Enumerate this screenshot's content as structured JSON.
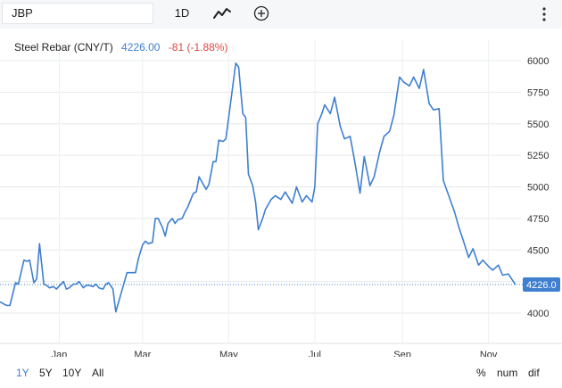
{
  "toolbar": {
    "symbol_value": "JBP",
    "interval_label": "1D",
    "chart_type_icon": "line-chart-icon",
    "add_icon": "plus-circle-icon",
    "more_icon": "vertical-dots-icon"
  },
  "legend": {
    "name": "Steel Rebar (CNY/T)",
    "price": "4226.00",
    "change": "-81 (-1.88%)"
  },
  "colors": {
    "line": "#3f7fd0",
    "change_negative": "#e0463f",
    "last_price_label_bg": "#3f7fd0"
  },
  "bottom": {
    "ranges": [
      "1Y",
      "5Y",
      "10Y",
      "All"
    ],
    "active_range": "1Y",
    "modes": [
      "%",
      "num",
      "dif"
    ]
  },
  "chart_data": {
    "type": "line",
    "title": "Steel Rebar (CNY/T)",
    "last_value": 4226.0,
    "last_value_label": "4226.0",
    "ylim": [
      3750,
      6100
    ],
    "yticks": [
      4000,
      4250,
      4500,
      4750,
      5000,
      5250,
      5500,
      5750,
      6000
    ],
    "ytick_labels": [
      "4000",
      "4250",
      "4500",
      "4750",
      "5000",
      "5250",
      "5500",
      "5750",
      "6000"
    ],
    "xlim": [
      "2020-11-20",
      "2021-11-24"
    ],
    "xticks": [
      {
        "date": "2021-01-01",
        "label": "Jan"
      },
      {
        "date": "2021-03-01",
        "label": "Mar"
      },
      {
        "date": "2021-05-01",
        "label": "May"
      },
      {
        "date": "2021-07-01",
        "label": "Jul"
      },
      {
        "date": "2021-09-01",
        "label": "Sep"
      },
      {
        "date": "2021-11-01",
        "label": "Nov"
      }
    ],
    "grid": true,
    "series": [
      {
        "x": [
          "2020-11-20",
          "2020-11-23",
          "2020-11-25",
          "2020-11-27",
          "2020-12-01",
          "2020-12-03",
          "2020-12-07",
          "2020-12-09",
          "2020-12-11",
          "2020-12-14",
          "2020-12-16",
          "2020-12-18",
          "2020-12-21",
          "2020-12-23",
          "2020-12-25",
          "2020-12-28",
          "2020-12-30",
          "2021-01-04",
          "2021-01-06",
          "2021-01-08",
          "2021-01-11",
          "2021-01-13",
          "2021-01-15",
          "2021-01-18",
          "2021-01-20",
          "2021-01-22",
          "2021-01-25",
          "2021-01-27",
          "2021-01-29",
          "2021-02-01",
          "2021-02-03",
          "2021-02-05",
          "2021-02-08",
          "2021-02-10",
          "2021-02-18",
          "2021-02-22",
          "2021-02-24",
          "2021-02-26",
          "2021-03-01",
          "2021-03-03",
          "2021-03-05",
          "2021-03-08",
          "2021-03-10",
          "2021-03-12",
          "2021-03-15",
          "2021-03-17",
          "2021-03-19",
          "2021-03-22",
          "2021-03-24",
          "2021-03-26",
          "2021-03-29",
          "2021-03-31",
          "2021-04-02",
          "2021-04-06",
          "2021-04-08",
          "2021-04-10",
          "2021-04-13",
          "2021-04-15",
          "2021-04-17",
          "2021-04-20",
          "2021-04-22",
          "2021-04-24",
          "2021-04-27",
          "2021-04-29",
          "2021-05-06",
          "2021-05-08",
          "2021-05-11",
          "2021-05-13",
          "2021-05-15",
          "2021-05-18",
          "2021-05-20",
          "2021-05-22",
          "2021-05-25",
          "2021-05-27",
          "2021-05-31",
          "2021-06-03",
          "2021-06-07",
          "2021-06-10",
          "2021-06-15",
          "2021-06-18",
          "2021-06-22",
          "2021-06-25",
          "2021-06-29",
          "2021-07-01",
          "2021-07-03",
          "2021-07-06",
          "2021-07-08",
          "2021-07-12",
          "2021-07-15",
          "2021-07-19",
          "2021-07-22",
          "2021-07-26",
          "2021-07-29",
          "2021-08-02",
          "2021-08-05",
          "2021-08-09",
          "2021-08-12",
          "2021-08-16",
          "2021-08-19",
          "2021-08-23",
          "2021-08-26",
          "2021-08-30",
          "2021-09-02",
          "2021-09-06",
          "2021-09-09",
          "2021-09-13",
          "2021-09-16",
          "2021-09-20",
          "2021-09-23",
          "2021-09-27",
          "2021-09-30",
          "2021-10-08",
          "2021-10-11",
          "2021-10-14",
          "2021-10-18",
          "2021-10-21",
          "2021-10-25",
          "2021-10-28",
          "2021-11-01",
          "2021-11-04",
          "2021-11-08",
          "2021-11-11",
          "2021-11-15",
          "2021-11-18",
          "2021-11-20"
        ],
        "values": [
          4090,
          4070,
          4060,
          4060,
          4240,
          4230,
          4420,
          4410,
          4420,
          4240,
          4270,
          4550,
          4230,
          4220,
          4200,
          4210,
          4190,
          4250,
          4190,
          4200,
          4230,
          4230,
          4250,
          4200,
          4220,
          4220,
          4210,
          4230,
          4200,
          4190,
          4230,
          4240,
          4190,
          4010,
          4320,
          4320,
          4320,
          4430,
          4540,
          4570,
          4550,
          4560,
          4750,
          4750,
          4680,
          4610,
          4710,
          4750,
          4710,
          4740,
          4750,
          4800,
          4840,
          4950,
          4960,
          5080,
          5020,
          4980,
          5020,
          5200,
          5200,
          5370,
          5360,
          5380,
          5980,
          5950,
          5580,
          5550,
          5100,
          5010,
          4880,
          4660,
          4750,
          4820,
          4900,
          4930,
          4900,
          4960,
          4870,
          5000,
          4880,
          4930,
          4880,
          5000,
          5500,
          5580,
          5650,
          5580,
          5710,
          5480,
          5380,
          5400,
          5220,
          4950,
          5240,
          5010,
          5080,
          5280,
          5400,
          5440,
          5570,
          5870,
          5830,
          5800,
          5870,
          5780,
          5930,
          5660,
          5610,
          5620,
          5050,
          4800,
          4680,
          4580,
          4440,
          4510,
          4380,
          4420,
          4370,
          4340,
          4380,
          4300,
          4310,
          4260,
          4226
        ]
      }
    ]
  }
}
